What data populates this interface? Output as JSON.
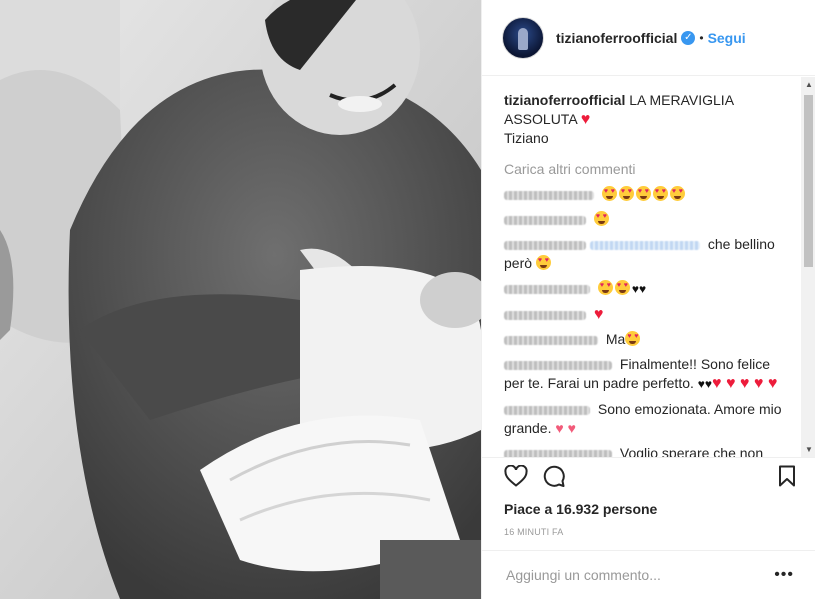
{
  "post": {
    "username": "tizianoferroofficial",
    "follow_label": "Segui",
    "separator": "•",
    "verified_mark": "✓"
  },
  "caption": {
    "username": "tizianoferroofficial",
    "text_line1": "LA MERAVIGLIA",
    "text_line2": "ASSOLUTA",
    "signature": "Tiziano"
  },
  "load_more_label": "Carica altri commenti",
  "comments": [
    {
      "text": ""
    },
    {
      "text": ""
    },
    {
      "text": "che bellino però"
    },
    {
      "text": ""
    },
    {
      "text": ""
    },
    {
      "text": "Ma"
    },
    {
      "text": "Finalmente!! Sono felice per te. Farai un padre perfetto."
    },
    {
      "text": "Sono emozionata. Amore mio grande."
    },
    {
      "text": "Voglio sperare che non"
    }
  ],
  "likes": {
    "prefix": "Piace a",
    "count": "16.932",
    "suffix": "persone"
  },
  "timestamp": "16 MINUTI FA",
  "add_comment_placeholder": "Aggiungi un commento...",
  "more_label": "•••",
  "icons": [
    "heart-icon",
    "comment-icon",
    "bookmark-icon"
  ],
  "colors": {
    "link": "#3897f0",
    "heart": "#ed1c3b",
    "muted": "#999999"
  }
}
